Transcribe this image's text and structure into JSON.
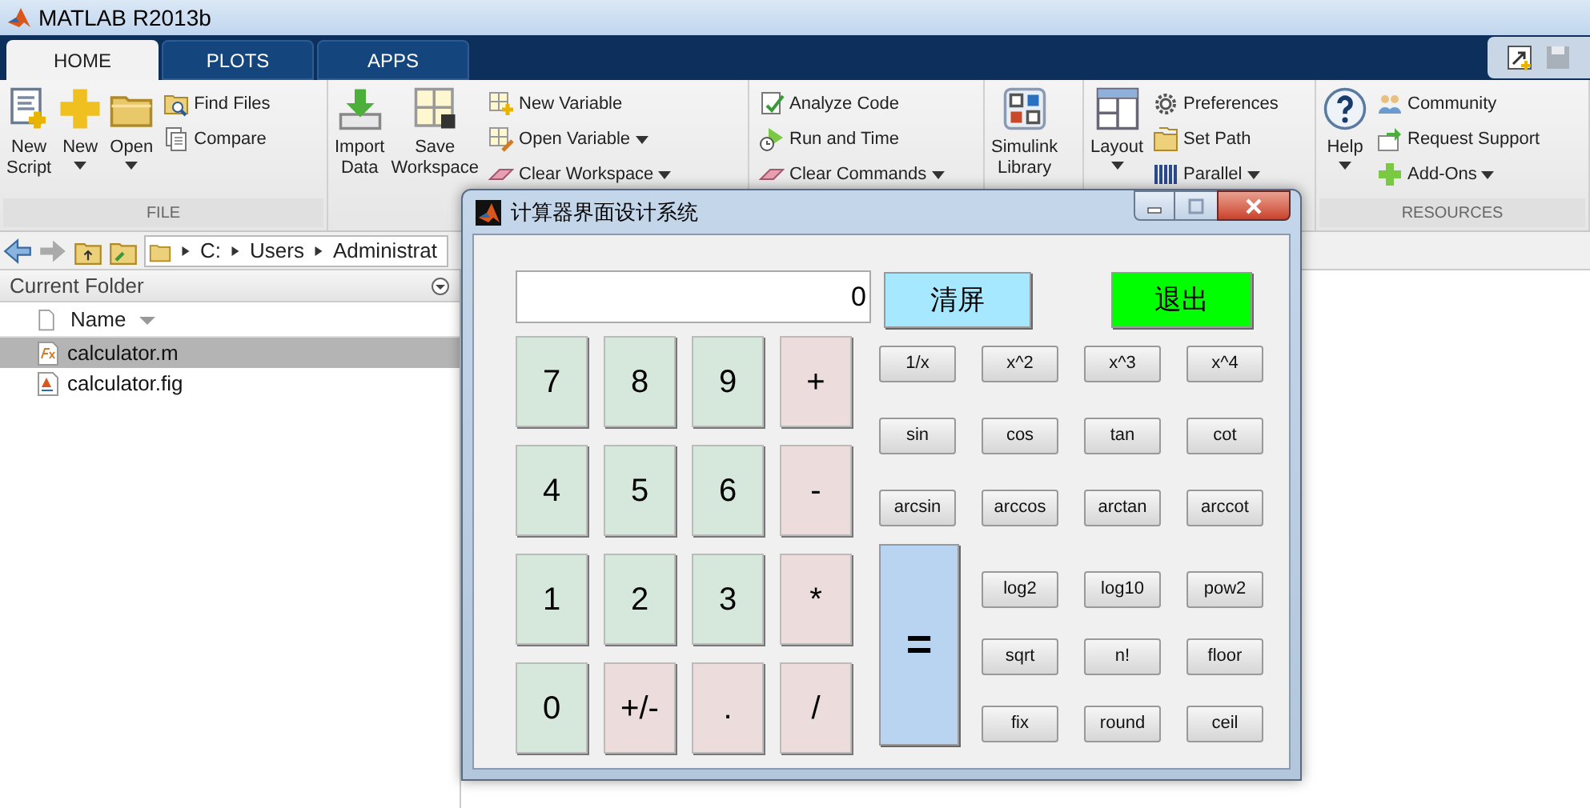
{
  "window": {
    "title": "MATLAB R2013b"
  },
  "tabs": [
    {
      "label": "HOME",
      "selected": true
    },
    {
      "label": "PLOTS",
      "selected": false
    },
    {
      "label": "APPS",
      "selected": false
    }
  ],
  "ribbon": {
    "sections": [
      {
        "label": "FILE",
        "items": [
          {
            "kind": "large",
            "lines": [
              "New",
              "Script"
            ],
            "dropdown": false
          },
          {
            "kind": "large",
            "lines": [
              "New"
            ],
            "dropdown": true
          },
          {
            "kind": "large",
            "lines": [
              "Open"
            ],
            "dropdown": true
          },
          {
            "kind": "small",
            "label": "Find Files",
            "dropdown": false
          },
          {
            "kind": "small",
            "label": "Compare",
            "dropdown": false
          }
        ]
      },
      {
        "items": [
          {
            "kind": "large",
            "lines": [
              "Import",
              "Data"
            ],
            "dropdown": false
          },
          {
            "kind": "large",
            "lines": [
              "Save",
              "Workspace"
            ],
            "dropdown": false
          },
          {
            "kind": "small",
            "label": "New Variable",
            "dropdown": false
          },
          {
            "kind": "small",
            "label": "Open Variable",
            "dropdown": true
          },
          {
            "kind": "small",
            "label": "Clear Workspace",
            "dropdown": true
          }
        ]
      },
      {
        "items": [
          {
            "kind": "small",
            "label": "Analyze Code",
            "dropdown": false
          },
          {
            "kind": "small",
            "label": "Run and Time",
            "dropdown": false
          },
          {
            "kind": "small",
            "label": "Clear Commands",
            "dropdown": true
          }
        ]
      },
      {
        "items": [
          {
            "kind": "large",
            "lines": [
              "Simulink",
              "Library"
            ],
            "dropdown": false
          }
        ]
      },
      {
        "items": [
          {
            "kind": "large",
            "lines": [
              "Layout"
            ],
            "dropdown": true
          },
          {
            "kind": "small",
            "label": "Preferences",
            "dropdown": false
          },
          {
            "kind": "small",
            "label": "Set Path",
            "dropdown": false
          },
          {
            "kind": "small",
            "label": "Parallel",
            "dropdown": true
          }
        ]
      },
      {
        "label": "RESOURCES",
        "items": [
          {
            "kind": "large",
            "lines": [
              "Help"
            ],
            "dropdown": true
          },
          {
            "kind": "small",
            "label": "Community",
            "dropdown": false
          },
          {
            "kind": "small",
            "label": "Request Support",
            "dropdown": false
          },
          {
            "kind": "small",
            "label": "Add-Ons",
            "dropdown": true
          }
        ]
      }
    ]
  },
  "address_bar": {
    "path": [
      "C:",
      "Users",
      "Administrat"
    ]
  },
  "current_folder": {
    "title": "Current Folder",
    "column": "Name",
    "files": [
      {
        "name": "calculator.m",
        "selected": true
      },
      {
        "name": "calculator.fig",
        "selected": false
      }
    ]
  },
  "calculator": {
    "title": "计算器界面设计系统",
    "display": "0",
    "top_buttons": [
      {
        "label": "清屏",
        "color": "#a6e8ff"
      },
      {
        "label": "退出",
        "color": "#00ff00"
      }
    ],
    "keypad": [
      {
        "label": "7",
        "color": "#d6e7dc"
      },
      {
        "label": "8",
        "color": "#d6e7dc"
      },
      {
        "label": "9",
        "color": "#d6e7dc"
      },
      {
        "label": "+",
        "color": "#ecdcdc"
      },
      {
        "label": "4",
        "color": "#d6e7dc"
      },
      {
        "label": "5",
        "color": "#d6e7dc"
      },
      {
        "label": "6",
        "color": "#d6e7dc"
      },
      {
        "label": "-",
        "color": "#ecdcdc"
      },
      {
        "label": "1",
        "color": "#d6e7dc"
      },
      {
        "label": "2",
        "color": "#d6e7dc"
      },
      {
        "label": "3",
        "color": "#d6e7dc"
      },
      {
        "label": "*",
        "color": "#ecdcdc"
      },
      {
        "label": "0",
        "color": "#d6e7dc"
      },
      {
        "label": "+/-",
        "color": "#ecdcdc"
      },
      {
        "label": ".",
        "color": "#ecdcdc"
      },
      {
        "label": "/",
        "color": "#ecdcdc"
      }
    ],
    "function_keys": [
      "1/x",
      "x^2",
      "x^3",
      "x^4",
      "sin",
      "cos",
      "tan",
      "cot",
      "arcsin",
      "arccos",
      "arctan",
      "arccot"
    ],
    "equals_key": "=",
    "more_function_keys": [
      "log2",
      "log10",
      "pow2",
      "sqrt",
      "n!",
      "floor",
      "fix",
      "round",
      "ceil"
    ]
  }
}
